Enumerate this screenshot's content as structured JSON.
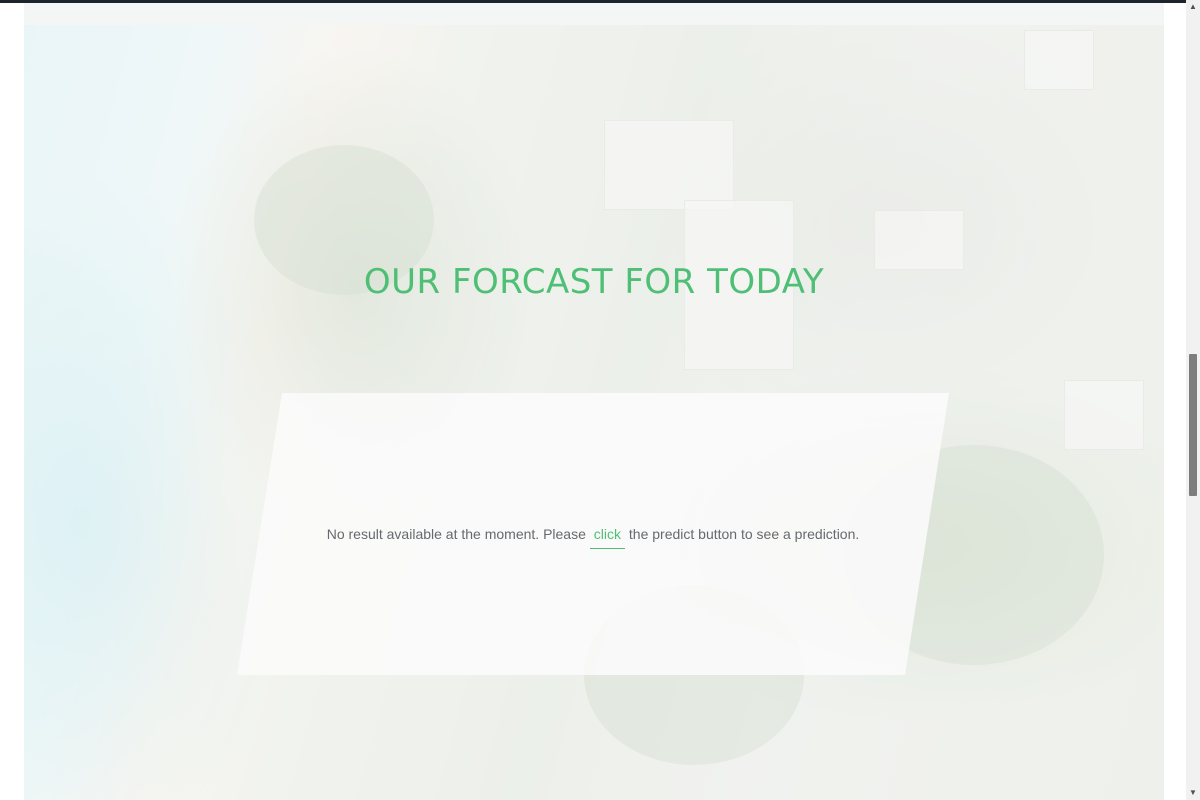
{
  "section": {
    "title": "OUR FORCAST FOR TODAY"
  },
  "result": {
    "text_before": "No result available at the moment. Please",
    "link_label": "click",
    "text_after": "the predict button to see a prediction."
  },
  "scrollbar": {
    "up_icon": "▲",
    "down_icon": "▼"
  },
  "colors": {
    "accent": "#4fbf76",
    "body_text": "#666a6e"
  }
}
